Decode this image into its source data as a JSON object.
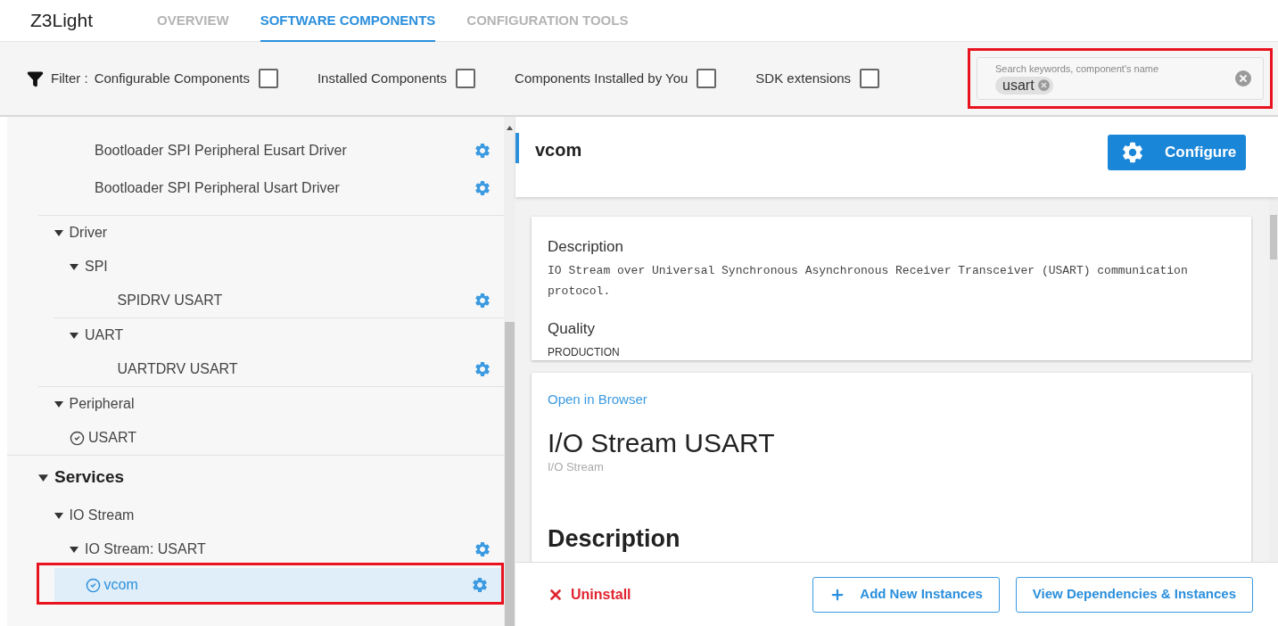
{
  "app": {
    "name": "Z3Light"
  },
  "tabs": [
    {
      "label": "OVERVIEW",
      "selected": false
    },
    {
      "label": "SOFTWARE COMPONENTS",
      "selected": true
    },
    {
      "label": "CONFIGURATION TOOLS",
      "selected": false
    }
  ],
  "filter": {
    "label": "Filter :",
    "options": [
      {
        "label": "Configurable Components",
        "checked": false
      },
      {
        "label": "Installed Components",
        "checked": false
      },
      {
        "label": "Components Installed by You",
        "checked": false
      },
      {
        "label": "SDK extensions",
        "checked": false
      }
    ]
  },
  "search": {
    "placeholder": "Search keywords, component's name",
    "tags": [
      "usart"
    ],
    "highlighted": true
  },
  "tree": {
    "scrolled_items": [
      {
        "label": "Bootloader SPI Peripheral Eusart Driver",
        "configurable": true
      },
      {
        "label": "Bootloader SPI Peripheral Usart Driver",
        "configurable": true
      }
    ],
    "nodes": [
      {
        "kind": "group",
        "label": "Driver",
        "expanded": true,
        "children": [
          {
            "label": "SPI",
            "expanded": true,
            "children": [
              {
                "label": "SPIDRV USART",
                "configurable": true
              }
            ]
          },
          {
            "label": "UART",
            "expanded": true,
            "children": [
              {
                "label": "UARTDRV USART",
                "configurable": true
              }
            ]
          }
        ]
      },
      {
        "kind": "group",
        "label": "Peripheral",
        "expanded": true,
        "children": [
          {
            "label": "USART",
            "installed": true
          }
        ]
      },
      {
        "kind": "category",
        "label": "Services",
        "expanded": true,
        "children": [
          {
            "label": "IO Stream",
            "expanded": true,
            "children": [
              {
                "label": "IO Stream: USART",
                "expanded": true,
                "configurable": true,
                "children": [
                  {
                    "label": "vcom",
                    "installed": true,
                    "configurable": true,
                    "selected": true,
                    "highlighted": true
                  }
                ]
              }
            ]
          }
        ]
      }
    ]
  },
  "detail": {
    "title": "vcom",
    "configure_button": "Configure",
    "summary": {
      "description_heading": "Description",
      "description": "IO Stream over Universal Synchronous Asynchronous Receiver Transceiver (USART) communication protocol.",
      "quality_heading": "Quality",
      "quality": "PRODUCTION"
    },
    "doc": {
      "link": "Open in Browser",
      "title": "I/O Stream USART",
      "subtitle": "I/O Stream",
      "section_heading": "Description"
    },
    "footer": {
      "uninstall": "Uninstall",
      "add_button": "Add New Instances",
      "view_button": "View Dependencies & Instances"
    }
  }
}
